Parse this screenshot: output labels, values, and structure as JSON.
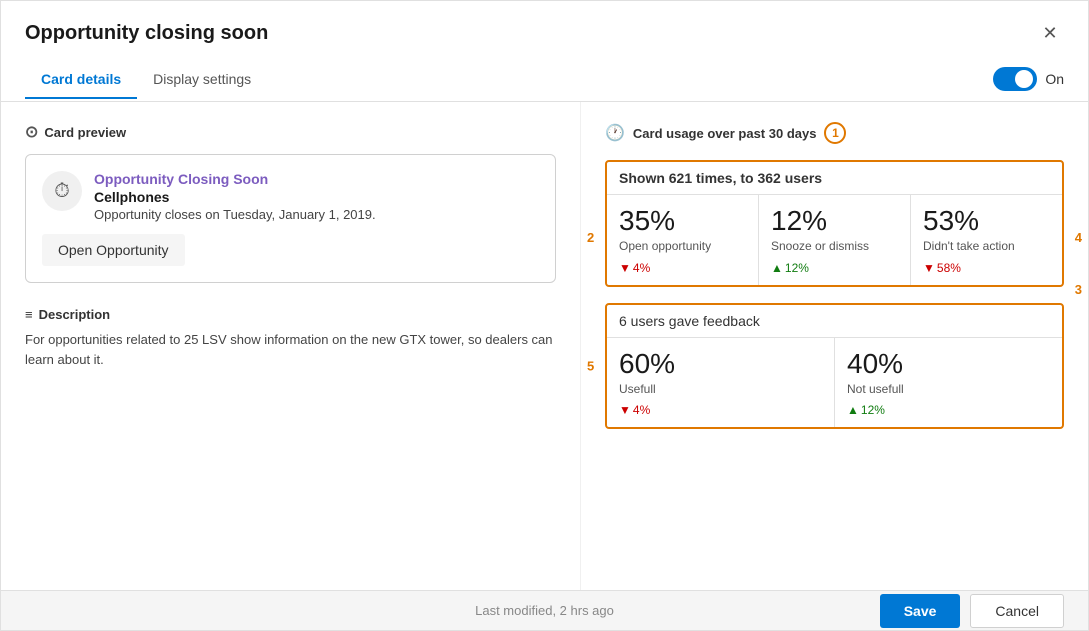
{
  "dialog": {
    "title": "Opportunity closing soon",
    "close_label": "✕"
  },
  "tabs": {
    "card_details": "Card details",
    "display_settings": "Display settings",
    "toggle_label": "On",
    "active_tab": "card_details"
  },
  "card_preview": {
    "section_title": "Card preview",
    "opportunity_title": "Opportunity Closing Soon",
    "subtitle": "Cellphones",
    "description": "Opportunity closes on Tuesday, January 1, 2019.",
    "action_button": "Open Opportunity"
  },
  "description_section": {
    "title": "Description",
    "text": "For opportunities related to 25 LSV show information on the new GTX tower, so dealers can learn about it."
  },
  "usage": {
    "section_title": "Card usage over past 30 days",
    "annotation": "1",
    "shown_text": "Shown 621 times, to 362 users",
    "stats": [
      {
        "pct": "35%",
        "label": "Open opportunity",
        "delta_dir": "down",
        "delta_val": "4%",
        "annotation": "2"
      },
      {
        "pct": "12%",
        "label": "Snooze or dismiss",
        "delta_dir": "up",
        "delta_val": "12%"
      },
      {
        "pct": "53%",
        "label": "Didn't take action",
        "delta_dir": "down",
        "delta_val": "58%",
        "annotation": "4"
      }
    ],
    "annotation_3": "3",
    "feedback": {
      "header": "6 users gave feedback",
      "annotation": "5",
      "cells": [
        {
          "pct": "60%",
          "label": "Usefull",
          "delta_dir": "down",
          "delta_val": "4%"
        },
        {
          "pct": "40%",
          "label": "Not usefull",
          "delta_dir": "up",
          "delta_val": "12%"
        }
      ]
    }
  },
  "footer": {
    "modified": "Last modified, 2 hrs ago",
    "save": "Save",
    "cancel": "Cancel"
  }
}
